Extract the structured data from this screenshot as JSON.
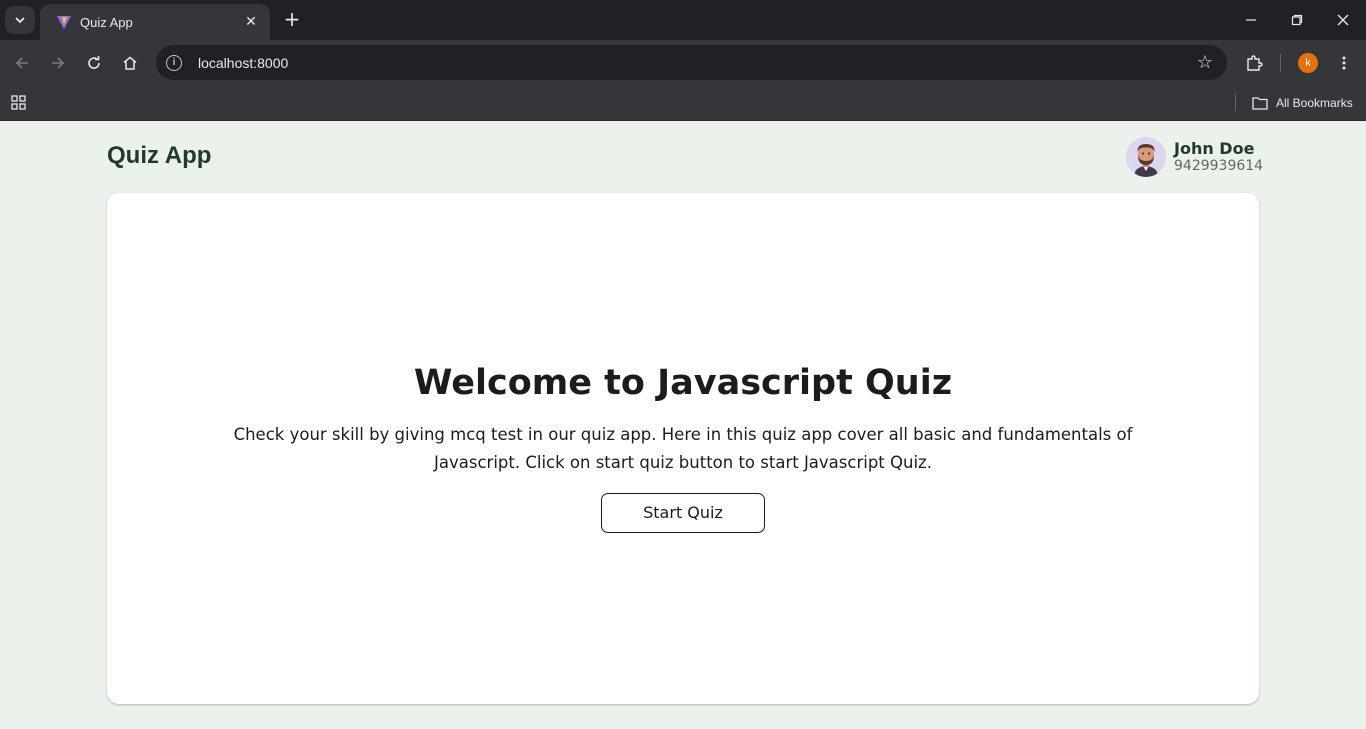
{
  "browser": {
    "tab_title": "Quiz App",
    "url": "localhost:8000",
    "bookmarks_label": "All Bookmarks",
    "profile_initial": "k"
  },
  "app": {
    "title": "Quiz App"
  },
  "user": {
    "name": "John Doe",
    "phone": "9429939614"
  },
  "welcome": {
    "headline": "Welcome to Javascript Quiz",
    "description": "Check your skill by giving mcq test in our quiz app. Here in this quiz app cover all basic and fundamentals of Javascript. Click on start quiz button to start Javascript Quiz.",
    "start_button": "Start Quiz"
  },
  "colors": {
    "page_background": "#ebf2eb",
    "title_color": "#1f3a2c",
    "profile_badge": "#e8710a"
  }
}
